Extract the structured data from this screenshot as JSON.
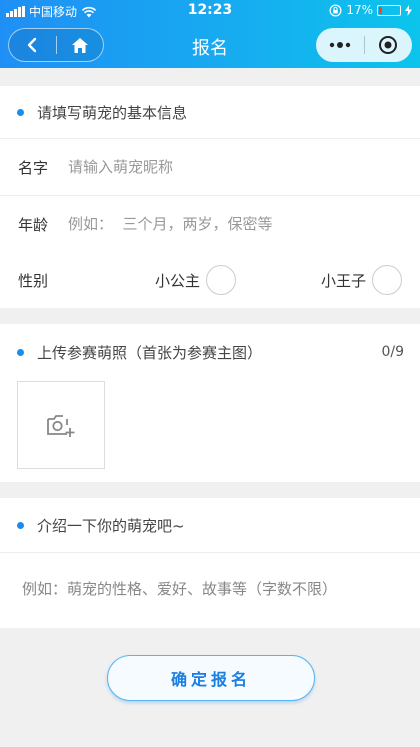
{
  "status_bar": {
    "carrier": "中国移动",
    "time": "12:23",
    "battery": "17%",
    "battery_level": 0.17
  },
  "nav": {
    "title": "报名"
  },
  "basic_info": {
    "section_title": "请填写萌宠的基本信息",
    "name_label": "名字",
    "name_placeholder": "请输入萌宠昵称",
    "age_label": "年龄",
    "age_placeholder": "例如：  三个月，两岁，保密等",
    "gender_label": "性别",
    "gender_options": [
      "小公主",
      "小王子"
    ]
  },
  "photos": {
    "section_title": "上传参赛萌照（首张为参赛主图）",
    "counter": "0/9"
  },
  "intro": {
    "section_title": "介绍一下你的萌宠吧~",
    "placeholder": "例如：萌宠的性格、爱好、故事等（字数不限）"
  },
  "submit_label": "确定报名",
  "colors": {
    "accent": "#1a8cf0",
    "header_start": "#1f8ff5",
    "header_end": "#0cc4ec"
  },
  "icons": [
    "back-arrow-icon",
    "home-icon",
    "more-dots-icon",
    "target-circle-icon",
    "camera-plus-icon",
    "wifi-icon",
    "lock-rotation-icon",
    "battery-icon",
    "charging-icon"
  ]
}
